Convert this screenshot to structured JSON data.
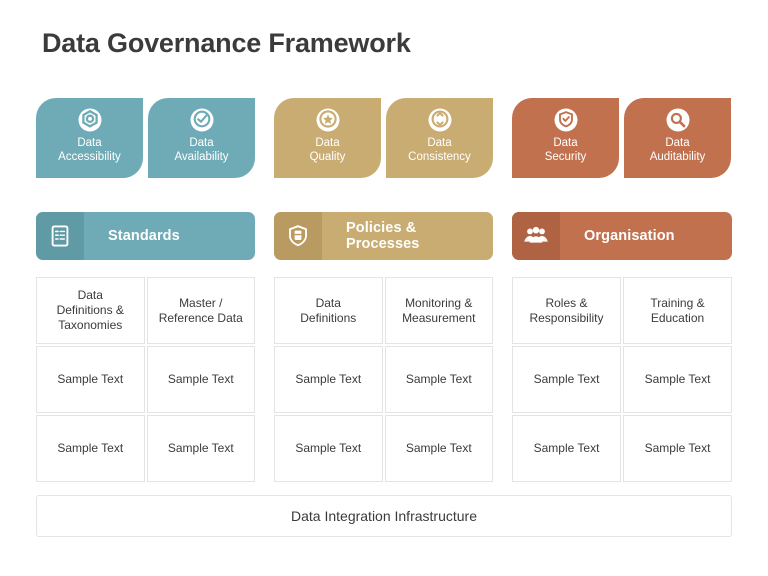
{
  "title": "Data Governance Framework",
  "colors": {
    "teal": "#6fabb6",
    "teal_dark": "#5f9aa5",
    "gold": "#c9ac72",
    "gold_dark": "#b99a60",
    "orange": "#c2714e",
    "orange_dark": "#b06343",
    "text_dark": "#3b3b3b",
    "cell_border": "#e4e4e4"
  },
  "pillars": [
    {
      "group": 1,
      "color_key": "teal",
      "icon": "hexagon-gear-icon",
      "line1": "Data",
      "line2": "Accessibility"
    },
    {
      "group": 1,
      "color_key": "teal",
      "icon": "check-circle-icon",
      "line1": "Data",
      "line2": "Availability"
    },
    {
      "group": 2,
      "color_key": "gold",
      "icon": "star-circle-icon",
      "line1": "Data",
      "line2": "Quality"
    },
    {
      "group": 2,
      "color_key": "gold",
      "icon": "sync-arrows-icon",
      "line1": "Data",
      "line2": "Consistency"
    },
    {
      "group": 3,
      "color_key": "orange",
      "icon": "shield-check-icon",
      "line1": "Data",
      "line2": "Security"
    },
    {
      "group": 3,
      "color_key": "orange",
      "icon": "magnifier-icon",
      "line1": "Data",
      "line2": "Auditability"
    }
  ],
  "banners": [
    {
      "label": "Standards",
      "icon": "checklist-clipboard-icon",
      "color_key": "teal"
    },
    {
      "label": "Policies & Processes",
      "icon": "shield-document-icon",
      "color_key": "gold"
    },
    {
      "label": "Organisation",
      "icon": "people-group-icon",
      "color_key": "orange"
    }
  ],
  "tables": [
    {
      "rows": [
        [
          {
            "line1": "Data",
            "line2": "Definitions &",
            "line3": "Taxonomies"
          },
          {
            "line1": "Master /",
            "line2": "Reference Data",
            "line3": ""
          }
        ],
        [
          {
            "line1": "Sample Text",
            "line2": "",
            "line3": ""
          },
          {
            "line1": "Sample Text",
            "line2": "",
            "line3": ""
          }
        ],
        [
          {
            "line1": "Sample Text",
            "line2": "",
            "line3": ""
          },
          {
            "line1": "Sample Text",
            "line2": "",
            "line3": ""
          }
        ]
      ]
    },
    {
      "rows": [
        [
          {
            "line1": "Data",
            "line2": "Definitions",
            "line3": ""
          },
          {
            "line1": "Monitoring &",
            "line2": "Measurement",
            "line3": ""
          }
        ],
        [
          {
            "line1": "Sample Text",
            "line2": "",
            "line3": ""
          },
          {
            "line1": "Sample Text",
            "line2": "",
            "line3": ""
          }
        ],
        [
          {
            "line1": "Sample Text",
            "line2": "",
            "line3": ""
          },
          {
            "line1": "Sample Text",
            "line2": "",
            "line3": ""
          }
        ]
      ]
    },
    {
      "rows": [
        [
          {
            "line1": "Roles &",
            "line2": "Responsibility",
            "line3": ""
          },
          {
            "line1": "Training &",
            "line2": "Education",
            "line3": ""
          }
        ],
        [
          {
            "line1": "Sample Text",
            "line2": "",
            "line3": ""
          },
          {
            "line1": "Sample Text",
            "line2": "",
            "line3": ""
          }
        ],
        [
          {
            "line1": "Sample Text",
            "line2": "",
            "line3": ""
          },
          {
            "line1": "Sample Text",
            "line2": "",
            "line3": ""
          }
        ]
      ]
    }
  ],
  "footer": {
    "label": "Data Integration Infrastructure"
  }
}
